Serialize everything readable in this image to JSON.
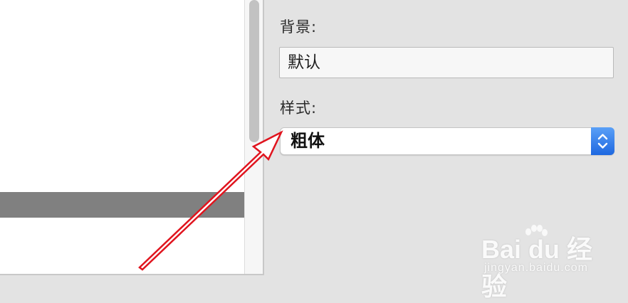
{
  "panel": {
    "background_label": "背景:",
    "background_value": "默认",
    "style_label": "样式:",
    "style_value": "粗体"
  },
  "colors": {
    "accent": "#1e68e0",
    "selected_row": "#808080",
    "annotation_arrow": "#e0141e"
  },
  "icons": {
    "stepper": "chevron-up-down-icon",
    "annotation": "red-arrow-icon"
  },
  "watermark": {
    "brand": "Bai du 经验",
    "url": "jingyan.baidu.com"
  }
}
